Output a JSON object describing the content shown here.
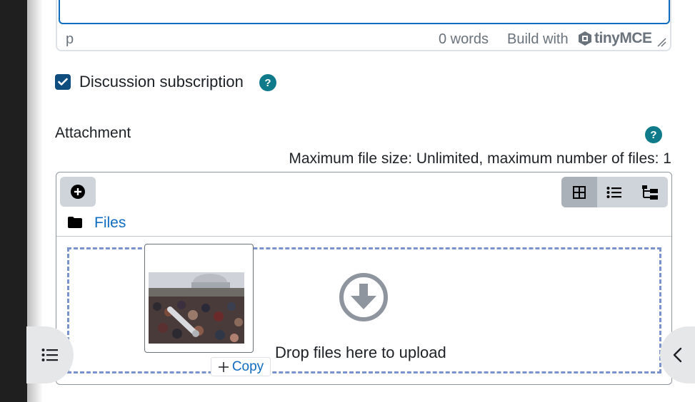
{
  "editor": {
    "status_path": "p",
    "word_count": "0 words",
    "build_with": "Build with",
    "brand": "tinyMCE"
  },
  "subscription": {
    "label": "Discussion subscription",
    "checked": true,
    "help": "?"
  },
  "attachment": {
    "label": "Attachment",
    "help": "?",
    "limits": "Maximum file size: Unlimited, maximum number of files: 1"
  },
  "filemanager": {
    "folder": "Files",
    "view_modes": [
      "grid-icon",
      "list-icon",
      "tree-icon"
    ],
    "active_view": "grid-icon",
    "drop_text": "Drop files here to upload",
    "drag_tag": "Copy",
    "drag_tag_icon": "plus-icon"
  },
  "colors": {
    "accent": "#0f6cbf",
    "help": "#0f7b8a",
    "checkbox": "#0f4d7e",
    "dropzone_border": "#7a93cc"
  }
}
